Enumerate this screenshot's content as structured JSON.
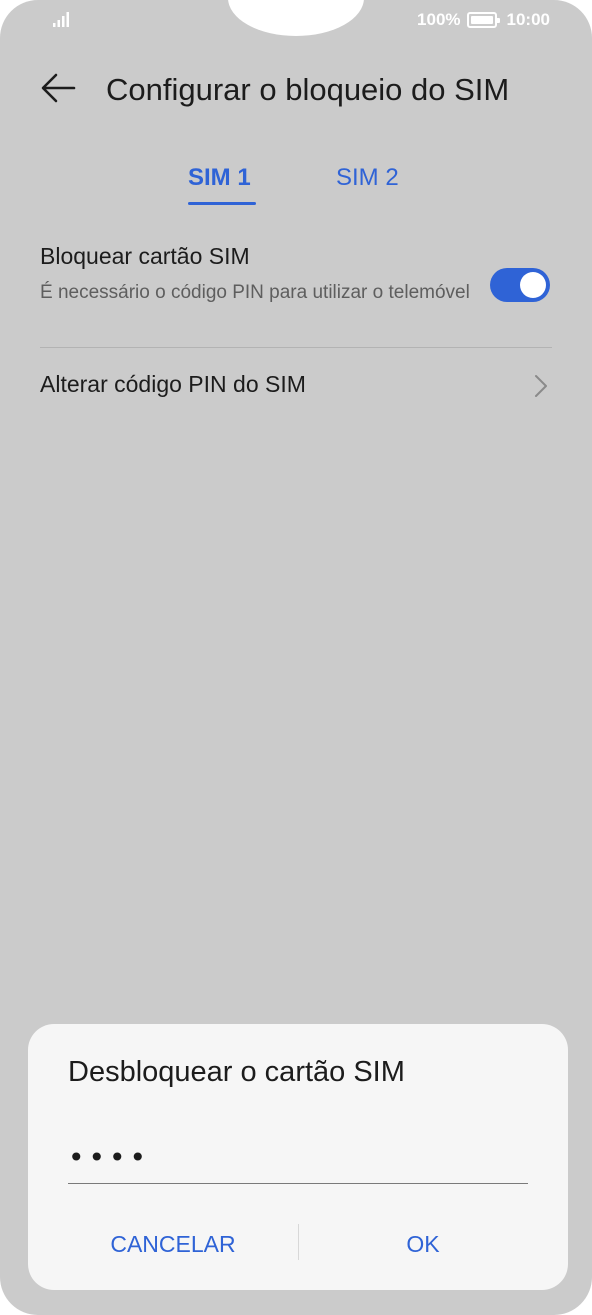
{
  "status_bar": {
    "battery_percent": "100%",
    "time": "10:00",
    "signal_icon": "signal-bars-icon",
    "battery_icon": "battery-icon"
  },
  "app_bar": {
    "back_icon": "arrow-left-icon",
    "title": "Configurar o bloqueio do SIM"
  },
  "tabs": [
    {
      "label": "SIM 1",
      "selected": true
    },
    {
      "label": "SIM 2",
      "selected": false
    }
  ],
  "settings": {
    "lock_sim": {
      "title": "Bloquear cartão SIM",
      "subtitle": "É necessário o código PIN para utilizar o telemóvel",
      "enabled": true
    },
    "change_pin": {
      "title": "Alterar código PIN do SIM",
      "icon": "chevron-right-icon"
    }
  },
  "dialog": {
    "title": "Desbloquear o cartão SIM",
    "pin_value": "••••",
    "cancel_label": "CANCELAR",
    "ok_label": "OK"
  },
  "colors": {
    "accent": "#2f63d6",
    "background_dimmed": "#cbcbcb",
    "dialog_background": "#f6f6f6"
  }
}
